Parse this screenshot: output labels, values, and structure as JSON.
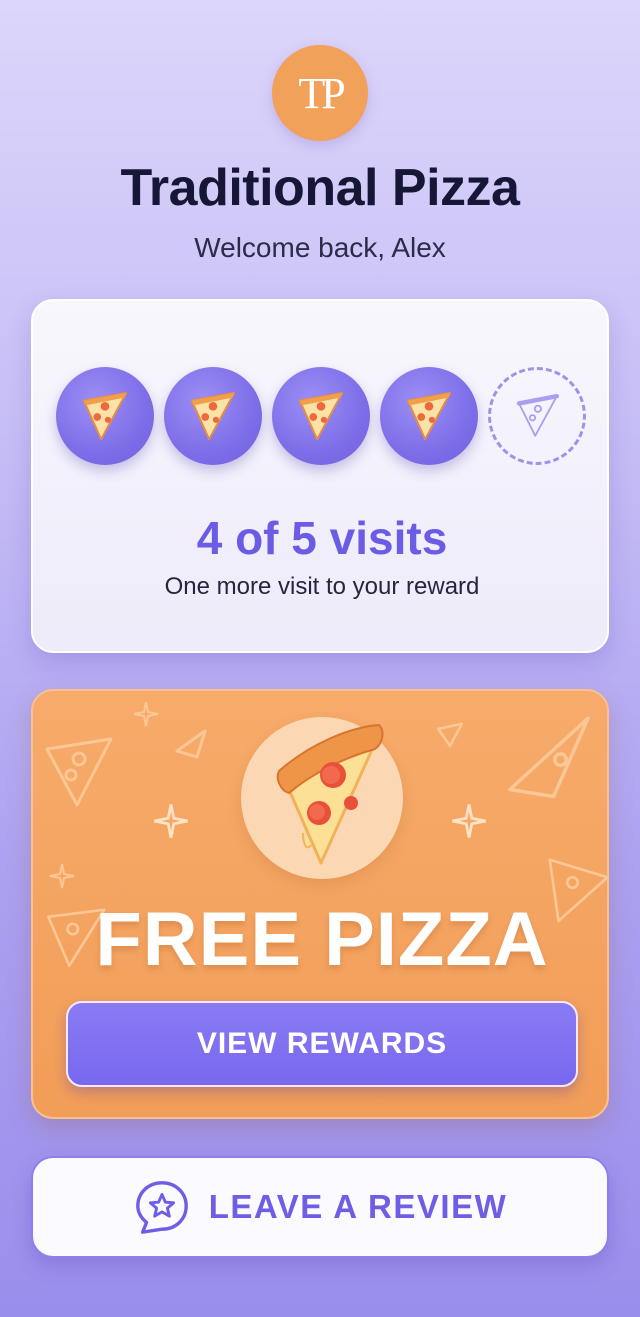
{
  "brand": {
    "logo_text": "TP",
    "name": "Traditional Pizza",
    "welcome": "Welcome back, Alex"
  },
  "stamp_card": {
    "stamps_total": 5,
    "stamps_collected": 4,
    "progress_label": "4 of 5 visits",
    "subtitle": "One more visit to your reward",
    "stamp_icon": "pizza-slice-icon"
  },
  "reward": {
    "title": "FREE PIZZA",
    "hero_icon": "pizza-slice-icon",
    "button_label": "VIEW REWARDS"
  },
  "review": {
    "label": "LEAVE A REVIEW",
    "icon": "star-speech-bubble-icon"
  },
  "colors": {
    "accent_purple": "#7868ee",
    "reward_orange": "#f29d58",
    "logo_orange": "#f2a15a",
    "title_dark": "#161636"
  }
}
